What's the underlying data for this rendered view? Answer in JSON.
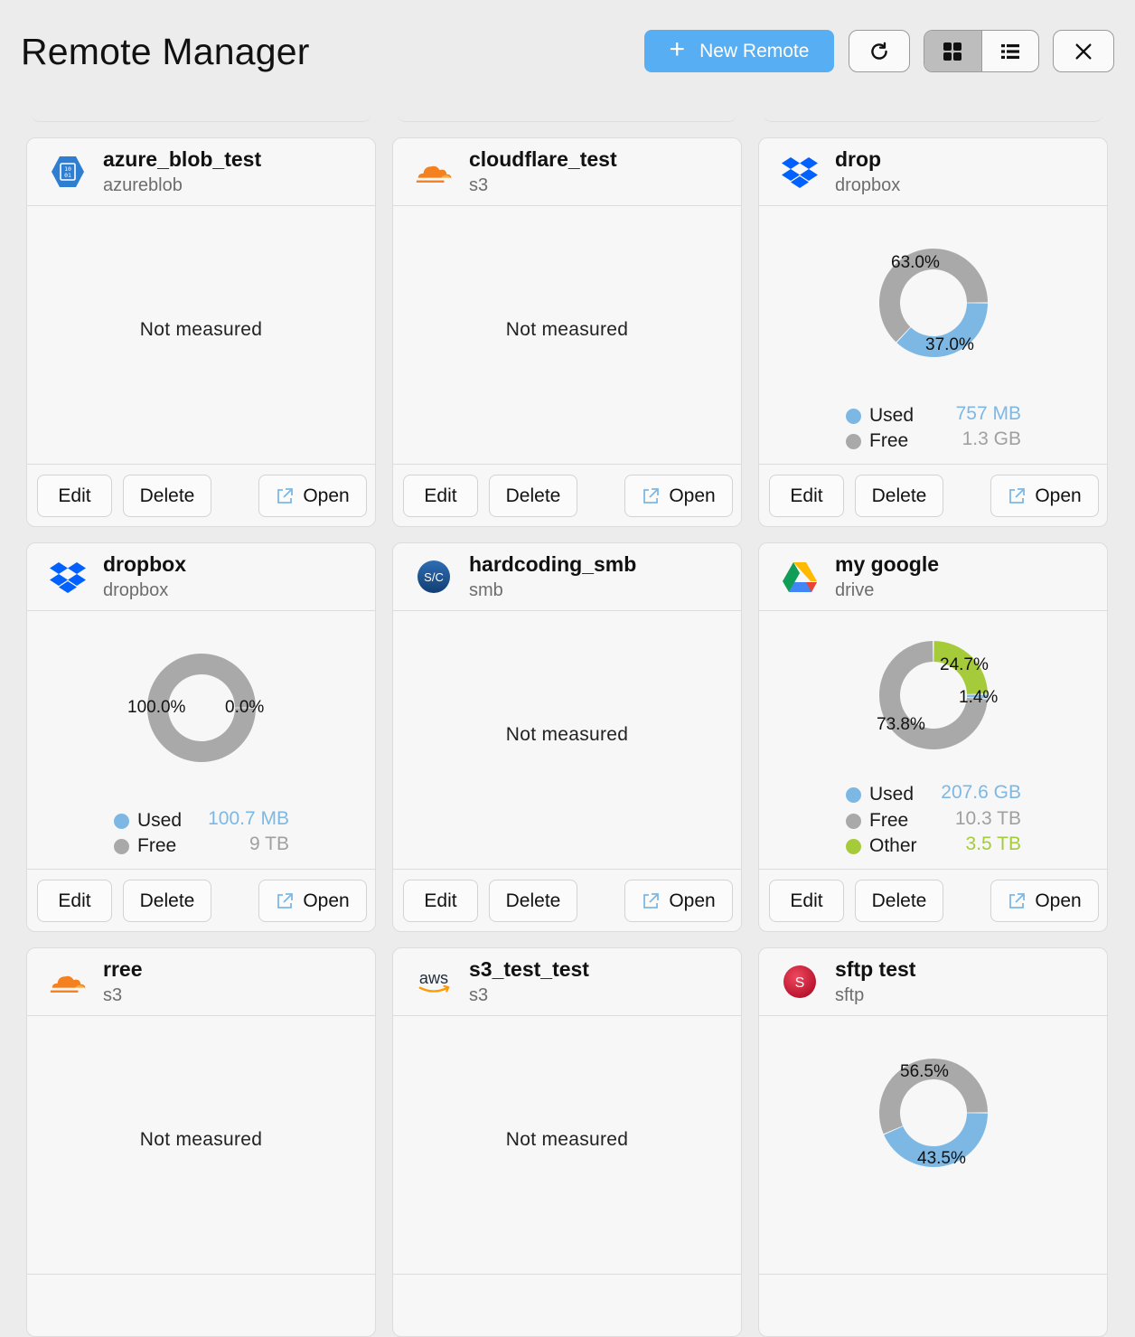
{
  "app": {
    "title": "Remote Manager",
    "new_remote_label": "New Remote",
    "refresh_icon": "refresh-icon",
    "grid_view_icon": "grid-icon",
    "list_view_icon": "list-icon",
    "close_icon": "close-icon",
    "accent": "#57aef2"
  },
  "colors": {
    "used": "#7db8e4",
    "free": "#a9a9a9",
    "other": "#a6cb3a"
  },
  "footer_labels": {
    "edit": "Edit",
    "delete": "Delete",
    "open": "Open"
  },
  "remotes": [
    {
      "name": "azure_blob_test",
      "type": "azureblob",
      "icon": "azure-blob-icon",
      "status": "Not measured"
    },
    {
      "name": "cloudflare_test",
      "type": "s3",
      "icon": "cloudflare-icon",
      "status": "Not measured"
    },
    {
      "name": "drop",
      "type": "dropbox",
      "icon": "dropbox-icon",
      "usage": {
        "percent_labels": {
          "free": "63.0%",
          "used": "37.0%"
        },
        "fractions": {
          "used": 0.37,
          "free": 0.63
        },
        "legend": [
          {
            "label": "Used",
            "value": "757 MB"
          },
          {
            "label": "Free",
            "value": "1.3 GB"
          }
        ]
      }
    },
    {
      "name": "dropbox",
      "type": "dropbox",
      "icon": "dropbox-icon",
      "usage": {
        "percent_labels": {
          "free": "100.0%",
          "used": "0.0%"
        },
        "fractions": {
          "used": 0.0,
          "free": 1.0
        },
        "legend": [
          {
            "label": "Used",
            "value": "100.7 MB"
          },
          {
            "label": "Free",
            "value": "9 TB"
          }
        ]
      }
    },
    {
      "name": "hardcoding_smb",
      "type": "smb",
      "icon": "smb-icon",
      "icon_text": "S/C",
      "status": "Not measured"
    },
    {
      "name": "my google",
      "type": "drive",
      "icon": "google-drive-icon",
      "usage": {
        "percent_labels": {
          "other": "24.7%",
          "used": "1.4%",
          "free": "73.8%"
        },
        "fractions": {
          "other": 0.247,
          "used": 0.014,
          "free": 0.738
        },
        "legend": [
          {
            "label": "Used",
            "value": "207.6 GB"
          },
          {
            "label": "Free",
            "value": "10.3 TB"
          },
          {
            "label": "Other",
            "value": "3.5 TB"
          }
        ]
      }
    },
    {
      "name": "rree",
      "type": "s3",
      "icon": "cloudflare-icon",
      "status": "Not measured"
    },
    {
      "name": "s3_test_test",
      "type": "s3",
      "icon": "aws-icon",
      "icon_text": "aws",
      "status": "Not measured"
    },
    {
      "name": "sftp test",
      "type": "sftp",
      "icon": "sftp-icon",
      "icon_text": "S",
      "usage": {
        "percent_labels": {
          "free": "56.5%",
          "used": "43.5%"
        },
        "fractions": {
          "used": 0.435,
          "free": 0.565
        }
      }
    }
  ]
}
